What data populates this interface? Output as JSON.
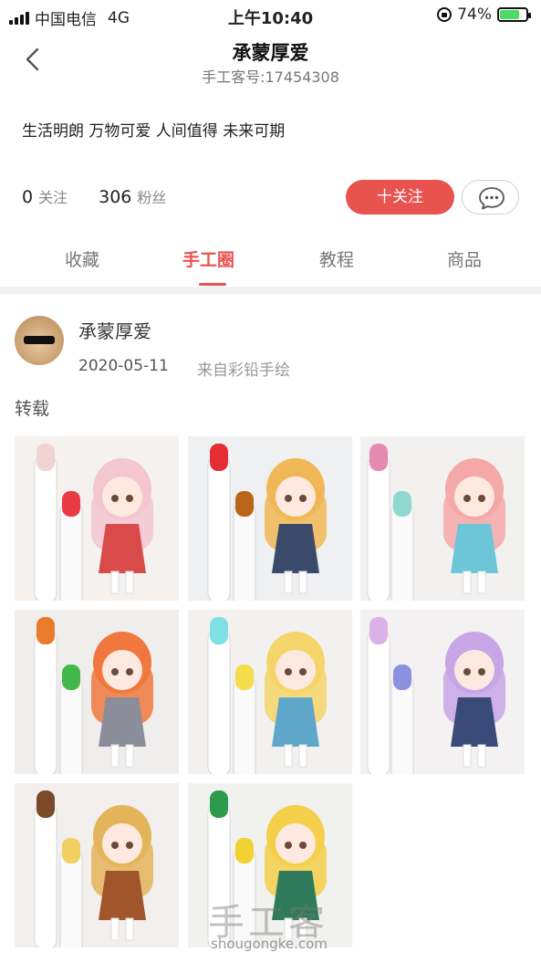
{
  "status_bar": {
    "carrier": "中国电信",
    "network": "4G",
    "time": "上午10:40",
    "battery": "74%",
    "battery_level": 0.74
  },
  "header": {
    "back_icon": "chevron-left-icon",
    "title": "承蒙厚爱",
    "subtitle": "手工客号:17454308"
  },
  "profile": {
    "bio": "生活明朗 万物可爱 人间值得 未来可期",
    "following_count": "0",
    "following_label": "关注",
    "followers_count": "306",
    "followers_label": "粉丝",
    "follow_button": "十关注",
    "message_icon": "chat-bubble-icon"
  },
  "tabs": [
    {
      "label": "收藏",
      "active": false
    },
    {
      "label": "手工圈",
      "active": true
    },
    {
      "label": "教程",
      "active": false
    },
    {
      "label": "商品",
      "active": false
    }
  ],
  "post": {
    "author": "承蒙厚爱",
    "date": "2020-05-11",
    "source": "来自彩铅手绘",
    "tag": "转载",
    "images": [
      {
        "bg": "#f4f1ef",
        "hair": "#f3c6d0",
        "marker_caps": [
          "#f1d3d2",
          "#e93a45"
        ],
        "outfit": "#d94a4a"
      },
      {
        "bg": "#eef0f2",
        "hair": "#f0b756",
        "marker_caps": [
          "#e42d35",
          "#b9651a"
        ],
        "outfit": "#3b4a6b"
      },
      {
        "bg": "#f3f1f0",
        "hair": "#f5a8a8",
        "marker_caps": [
          "#e58ab0",
          "#8fd8d0"
        ],
        "outfit": "#6cc6d8"
      },
      {
        "bg": "#f0eeec",
        "hair": "#f0773e",
        "marker_caps": [
          "#ea7a2c",
          "#43b84a"
        ],
        "outfit": "#8b8e9a"
      },
      {
        "bg": "#f2f1ef",
        "hair": "#f4d56a",
        "marker_caps": [
          "#7ee0e4",
          "#f4dc4c"
        ],
        "outfit": "#5fa7c9"
      },
      {
        "bg": "#f3f1f2",
        "hair": "#c7a6e6",
        "marker_caps": [
          "#dcb1e8",
          "#8a92e0"
        ],
        "outfit": "#3a4b7a"
      },
      {
        "bg": "#f2efec",
        "hair": "#e4b45a",
        "marker_caps": [
          "#7a4a2a",
          "#f0d060"
        ],
        "outfit": "#a0552a"
      },
      {
        "bg": "#f1f1ef",
        "hair": "#f3cf4a",
        "marker_caps": [
          "#2e9a4c",
          "#f2d233"
        ],
        "outfit": "#2e7a5a"
      }
    ]
  },
  "watermark": {
    "text": "手工客",
    "url": "shougongke.com"
  },
  "colors": {
    "accent": "#e8524f",
    "muted": "#888888",
    "divider": "#f2f2f2"
  }
}
